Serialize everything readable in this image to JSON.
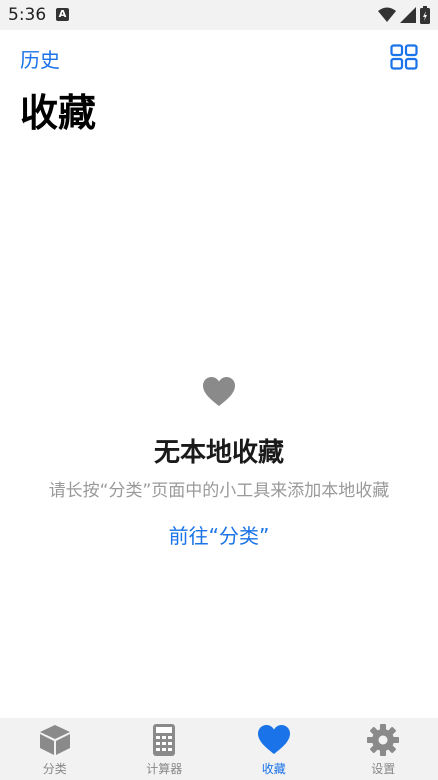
{
  "status_bar": {
    "time": "5:36",
    "notification_glyph": "A"
  },
  "header": {
    "history_label": "历史",
    "grid_icon": "grid-icon"
  },
  "page": {
    "title": "收藏"
  },
  "empty_state": {
    "icon": "heart-icon",
    "title": "无本地收藏",
    "description": "请长按“分类”页面中的小工具来添加本地收藏",
    "link_label": "前往“分类”"
  },
  "tabbar": {
    "tabs": [
      {
        "label": "分类",
        "icon": "cube-icon",
        "active": false
      },
      {
        "label": "计算器",
        "icon": "calculator-icon",
        "active": false
      },
      {
        "label": "收藏",
        "icon": "heart-icon",
        "active": true
      },
      {
        "label": "设置",
        "icon": "gear-icon",
        "active": false
      }
    ]
  },
  "colors": {
    "accent": "#1a73e8",
    "muted": "#9a9a9a",
    "icon_gray": "#8a8a8a",
    "bar_bg": "#f2f2f2"
  }
}
